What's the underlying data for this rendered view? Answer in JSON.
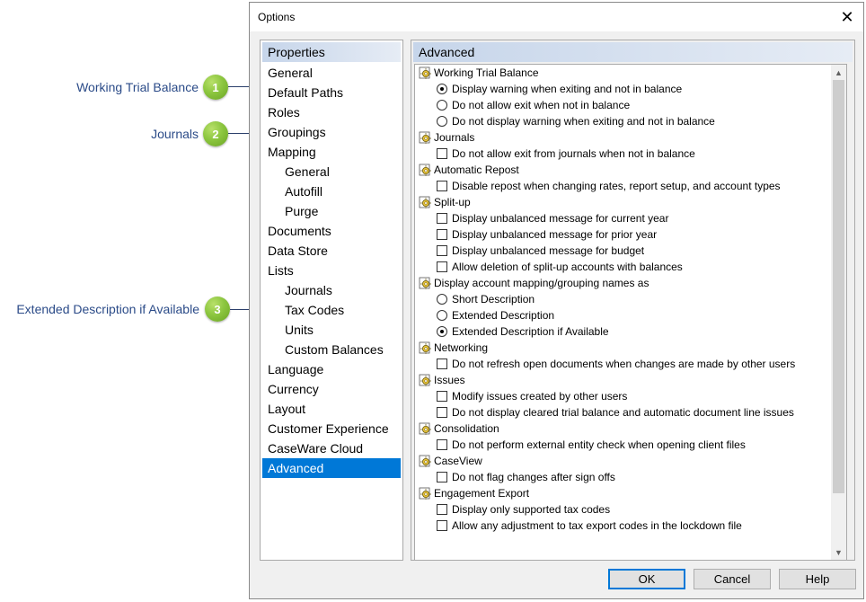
{
  "callouts": [
    {
      "number": "1",
      "label": "Working Trial Balance"
    },
    {
      "number": "2",
      "label": "Journals"
    },
    {
      "number": "3",
      "label": "Extended Description if Available"
    }
  ],
  "dialog": {
    "title": "Options",
    "close_icon": "close-icon",
    "left_panel": {
      "header": "Properties",
      "items": [
        {
          "label": "General"
        },
        {
          "label": "Default Paths"
        },
        {
          "label": "Roles"
        },
        {
          "label": "Groupings"
        },
        {
          "label": "Mapping"
        },
        {
          "label": "General"
        },
        {
          "label": "Autofill"
        },
        {
          "label": "Purge"
        },
        {
          "label": "Documents"
        },
        {
          "label": "Data Store"
        },
        {
          "label": "Lists"
        },
        {
          "label": "Journals"
        },
        {
          "label": "Tax Codes"
        },
        {
          "label": "Units"
        },
        {
          "label": "Custom Balances"
        },
        {
          "label": "Language"
        },
        {
          "label": "Currency"
        },
        {
          "label": "Layout"
        },
        {
          "label": "Customer Experience"
        },
        {
          "label": "CaseWare Cloud"
        },
        {
          "label": "Advanced"
        }
      ],
      "selected": "Advanced"
    },
    "right_panel": {
      "header": "Advanced",
      "groups": [
        {
          "label": "Working Trial Balance",
          "options": [
            {
              "type": "radio",
              "checked": true,
              "label": "Display warning when exiting and not in balance"
            },
            {
              "type": "radio",
              "checked": false,
              "label": "Do not allow exit when not in balance"
            },
            {
              "type": "radio",
              "checked": false,
              "label": "Do not display warning when exiting and not in balance"
            }
          ]
        },
        {
          "label": "Journals",
          "options": [
            {
              "type": "checkbox",
              "checked": false,
              "label": "Do not allow exit from journals when not in balance"
            }
          ]
        },
        {
          "label": "Automatic Repost",
          "options": [
            {
              "type": "checkbox",
              "checked": false,
              "label": "Disable repost when changing rates, report setup, and account types"
            }
          ]
        },
        {
          "label": "Split-up",
          "options": [
            {
              "type": "checkbox",
              "checked": false,
              "label": "Display unbalanced message for current year"
            },
            {
              "type": "checkbox",
              "checked": false,
              "label": "Display unbalanced message for  prior year"
            },
            {
              "type": "checkbox",
              "checked": false,
              "label": "Display unbalanced message for budget"
            },
            {
              "type": "checkbox",
              "checked": false,
              "label": "Allow deletion of split-up accounts with balances"
            }
          ]
        },
        {
          "label": "Display account mapping/grouping names as",
          "options": [
            {
              "type": "radio",
              "checked": false,
              "label": "Short Description"
            },
            {
              "type": "radio",
              "checked": false,
              "label": "Extended Description"
            },
            {
              "type": "radio",
              "checked": true,
              "label": "Extended Description if Available"
            }
          ]
        },
        {
          "label": "Networking",
          "options": [
            {
              "type": "checkbox",
              "checked": false,
              "label": "Do not refresh open documents when changes are made by other users"
            }
          ]
        },
        {
          "label": "Issues",
          "options": [
            {
              "type": "checkbox",
              "checked": false,
              "label": "Modify issues created by other users"
            },
            {
              "type": "checkbox",
              "checked": false,
              "label": "Do not display cleared trial balance and automatic document line issues"
            }
          ]
        },
        {
          "label": "Consolidation",
          "options": [
            {
              "type": "checkbox",
              "checked": false,
              "label": "Do not perform external entity check when opening client files"
            }
          ]
        },
        {
          "label": "CaseView",
          "options": [
            {
              "type": "checkbox",
              "checked": false,
              "label": "Do not flag changes after sign offs"
            }
          ]
        },
        {
          "label": "Engagement Export",
          "options": [
            {
              "type": "checkbox",
              "checked": false,
              "label": "Display only supported tax codes"
            },
            {
              "type": "checkbox",
              "checked": false,
              "label": "Allow any adjustment to tax export codes in the lockdown file"
            }
          ]
        }
      ]
    },
    "buttons": {
      "ok": "OK",
      "cancel": "Cancel",
      "help": "Help"
    }
  }
}
